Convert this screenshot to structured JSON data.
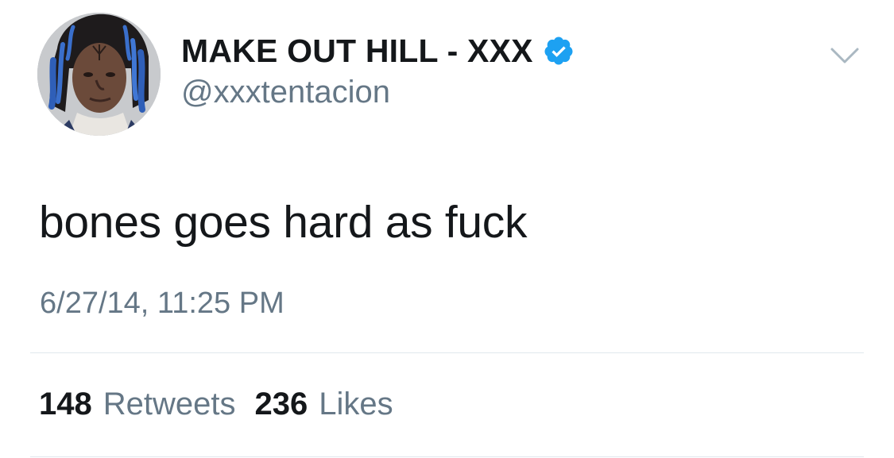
{
  "tweet": {
    "display_name": "MAKE OUT HILL - XXX",
    "handle": "@xxxtentacion",
    "verified": true,
    "text": "bones goes hard as fuck",
    "timestamp": "6/27/14, 11:25 PM",
    "stats": {
      "retweets_count": "148",
      "retweets_label": "Retweets",
      "likes_count": "236",
      "likes_label": "Likes"
    }
  },
  "icons": {
    "verified": "verified-badge-icon",
    "menu": "chevron-down-icon",
    "avatar": "profile-photo"
  },
  "colors": {
    "primary_text": "#14171a",
    "secondary_text": "#657786",
    "verified_blue": "#1da1f2",
    "divider": "#e1e8ed",
    "background": "#ffffff"
  }
}
